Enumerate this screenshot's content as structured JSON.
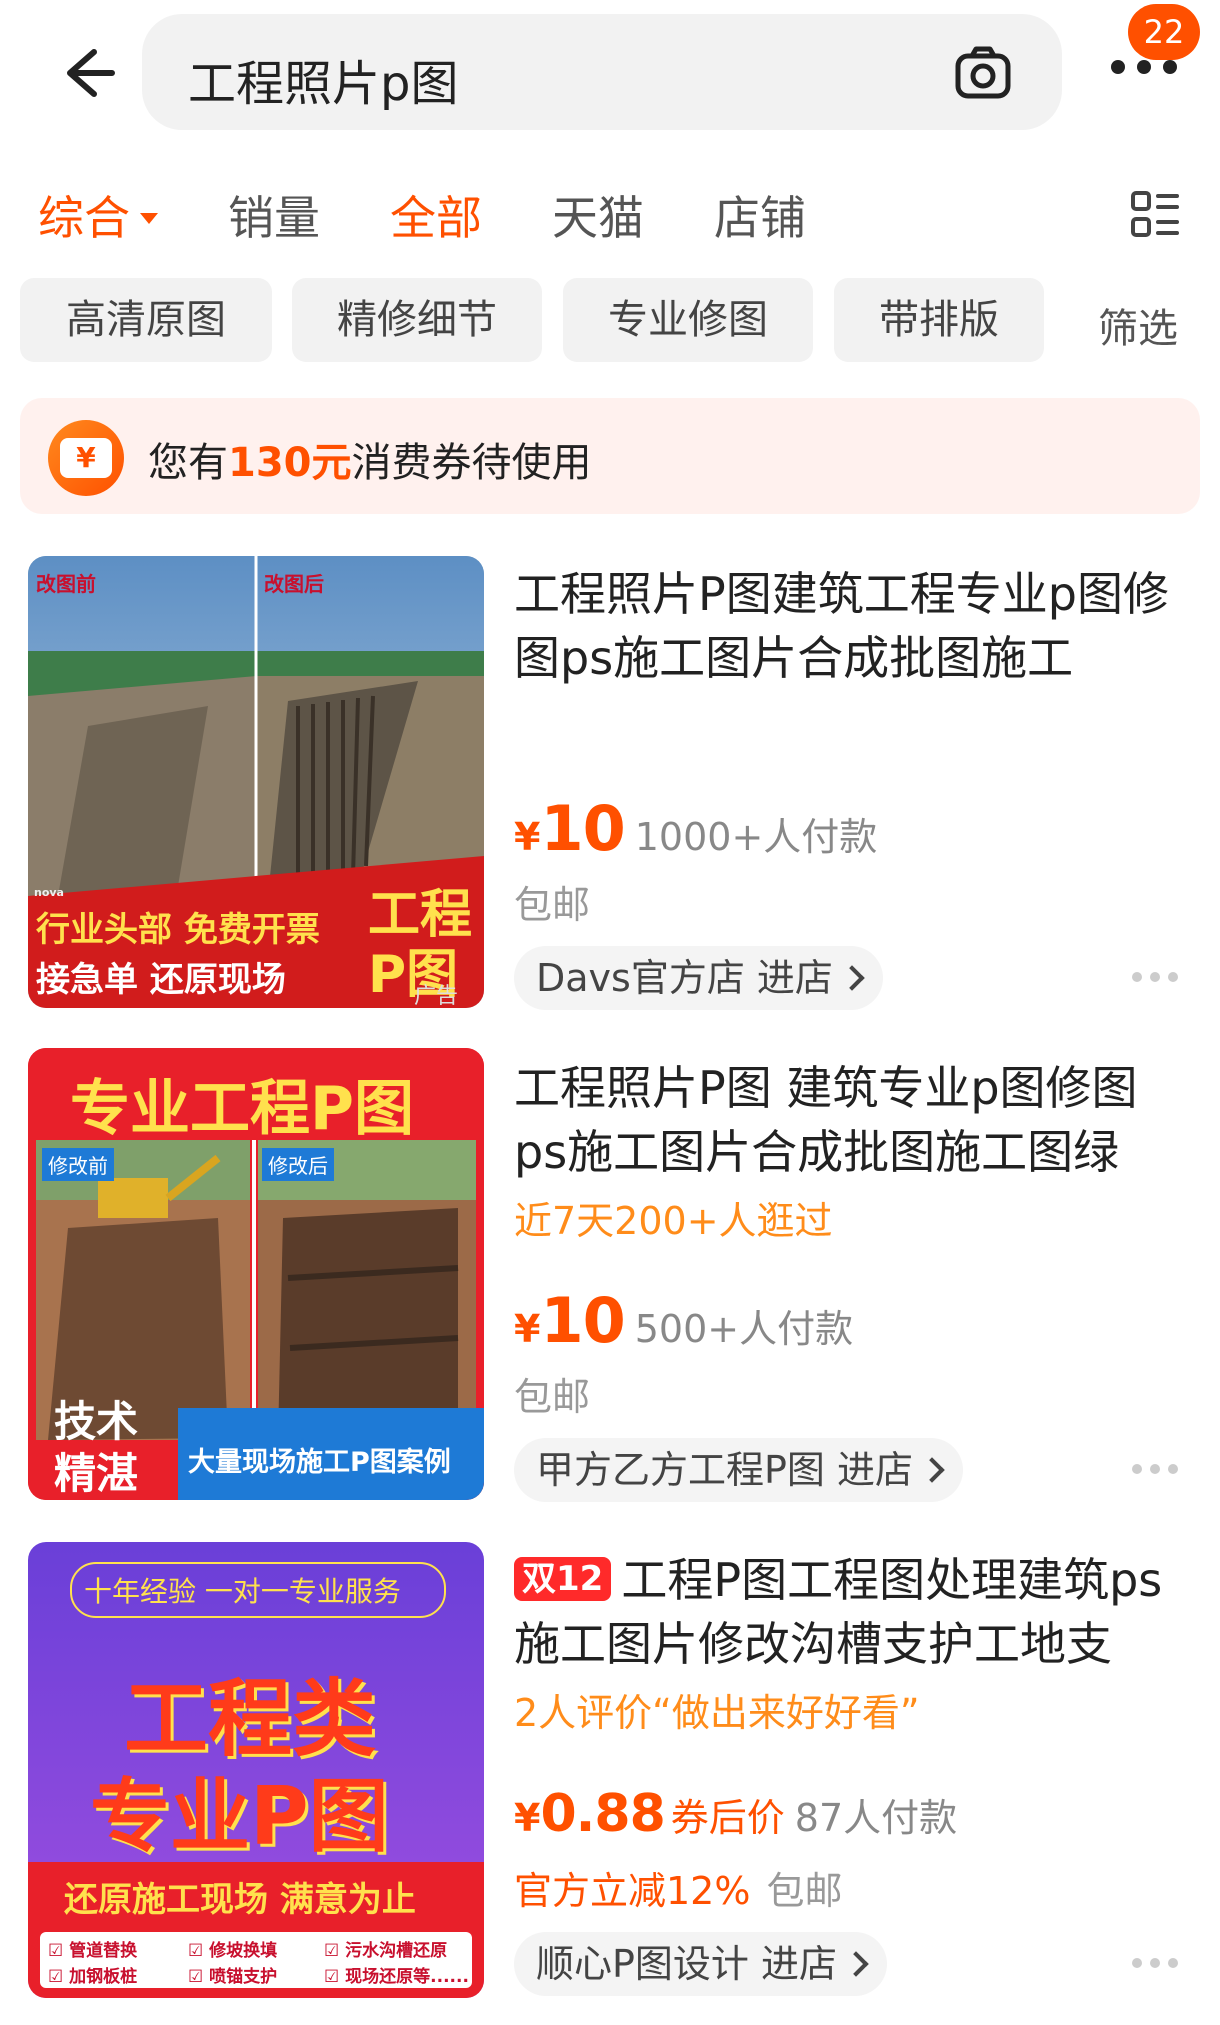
{
  "header": {
    "search_query": "工程照片p图",
    "notification_count": "22"
  },
  "sort_tabs": [
    {
      "label": "综合",
      "active": true
    },
    {
      "label": "销量",
      "active": false
    },
    {
      "label": "全部",
      "active": true
    },
    {
      "label": "天猫",
      "active": false
    },
    {
      "label": "店铺",
      "active": false
    }
  ],
  "filter_chips": [
    "高清原图",
    "精修细节",
    "专业修图",
    "带排版"
  ],
  "filter_label": "筛选",
  "coupon": {
    "prefix": "您有",
    "amount": "130元",
    "suffix": "消费券待使用",
    "icon_glyph": "¥"
  },
  "products": [
    {
      "title": "工程照片P图建筑工程专业p图修图ps施工图片合成批图施工",
      "currency": "¥",
      "price": "10",
      "sales": "1000+人付款",
      "shipping": "包邮",
      "shop": "Davs官方店 进店",
      "image": {
        "before": "改图前",
        "after": "改图后",
        "line1": "行业头部 免费开票",
        "line2": "接急单 还原现场",
        "big1": "工程",
        "big2": "P图",
        "ad": "广告",
        "brand": "nova"
      }
    },
    {
      "title": "工程照片P图 建筑专业p图修图ps施工图片合成批图施工图绿",
      "promo": "近7天200+人逛过",
      "currency": "¥",
      "price": "10",
      "sales": "500+人付款",
      "shipping": "包邮",
      "shop": "甲方乙方工程P图 进店",
      "image": {
        "headline": "专业工程P图",
        "before": "修改前",
        "after": "修改后",
        "badge1": "技术",
        "badge2": "精湛",
        "footer": "大量现场施工P图案例"
      }
    },
    {
      "tag": "双12",
      "title": "工程P图工程图处理建筑ps施工图片修改沟槽支护工地支",
      "promo": "2人评价“做出来好好看”",
      "currency": "¥",
      "price": "0.88",
      "after_coupon": "券后价",
      "sales": "87人付款",
      "discount": "官方立减12%",
      "shipping": "包邮",
      "shop": "顺心P图设计 进店",
      "image": {
        "top": "十年经验 一对一专业服务",
        "big1": "工程类",
        "big2": "专业P图",
        "mid": "还原施工现场 满意为止",
        "items": [
          "管道替换",
          "修坡换填",
          "污水沟槽还原",
          "加钢板桩",
          "喷锚支护",
          "现场还原等......"
        ]
      }
    }
  ],
  "colors": {
    "accent": "#ff5000",
    "promo": "#ff8c1a",
    "chip_bg": "#f2f2f2"
  }
}
